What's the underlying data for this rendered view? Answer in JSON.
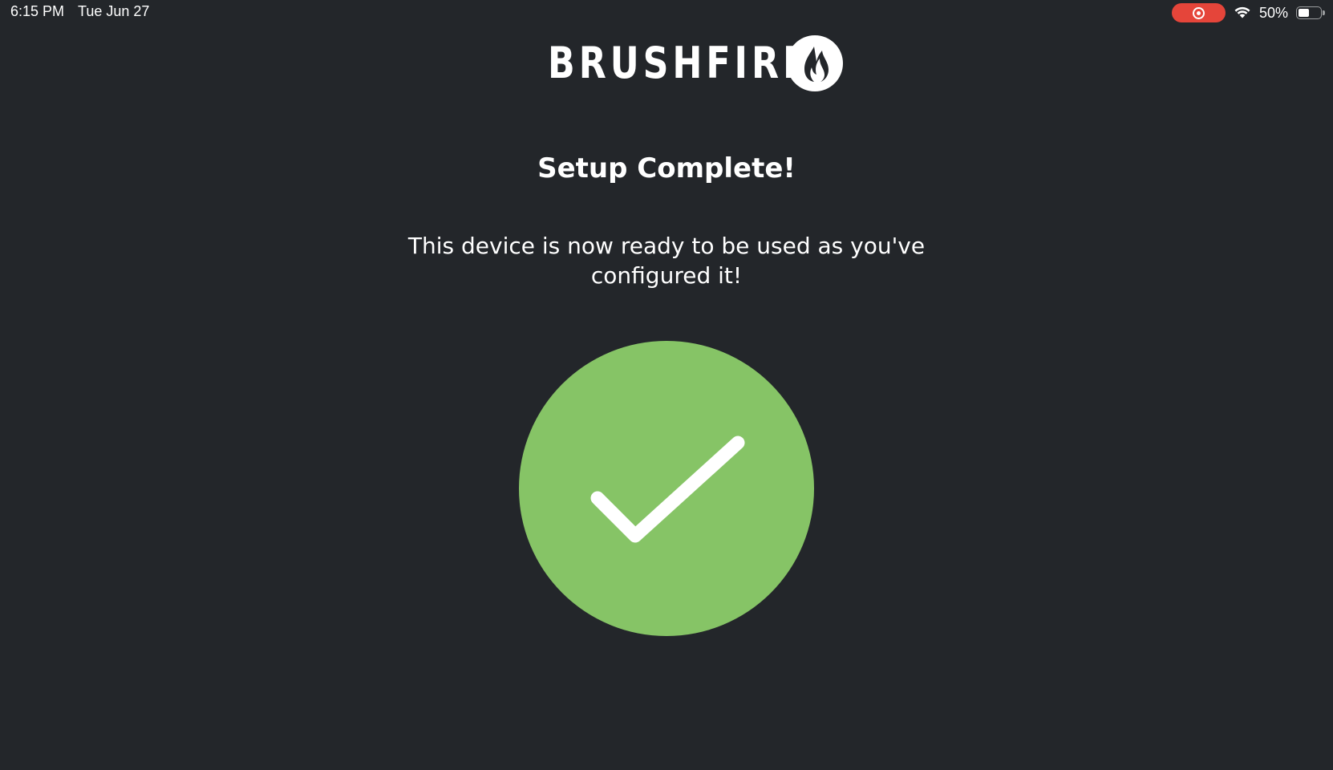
{
  "status_bar": {
    "time": "6:15 PM",
    "date": "Tue Jun 27",
    "battery_percent": "50%",
    "battery_level": 0.5,
    "recording_color": "#e5453a"
  },
  "brand": {
    "name": "BRUSHFIRE",
    "logo_icon": "flame-icon"
  },
  "setup": {
    "title": "Setup Complete!",
    "message": "This device is now ready to be used as you've configured it!",
    "status_icon": "checkmark-icon",
    "success_color": "#86c466"
  },
  "colors": {
    "background": "#23262a",
    "text": "#ffffff"
  }
}
